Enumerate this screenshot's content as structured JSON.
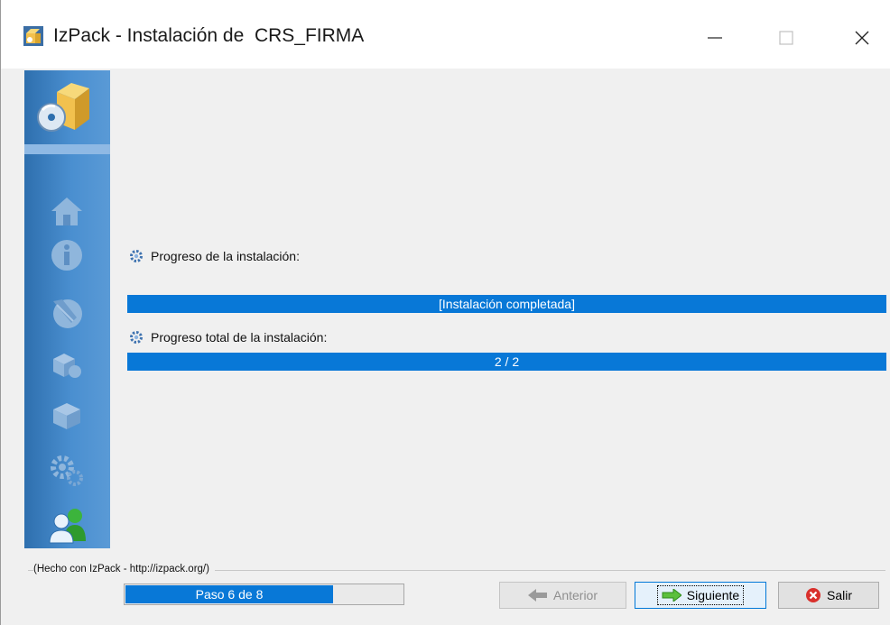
{
  "window": {
    "title": "IzPack - Instalación de  CRS_FIRMA",
    "controls": {
      "minimize": "minimize-icon",
      "maximize": "maximize-icon",
      "close": "close-icon"
    }
  },
  "sidebar": {
    "top_icon": "installer-box-icon",
    "steps": [
      {
        "icon": "home-icon",
        "state": "completed"
      },
      {
        "icon": "info-icon",
        "state": "completed"
      },
      {
        "icon": "license-icon",
        "state": "completed"
      },
      {
        "icon": "packs-icon",
        "state": "completed"
      },
      {
        "icon": "target-icon",
        "state": "completed"
      },
      {
        "icon": "settings-icon",
        "state": "completed"
      },
      {
        "icon": "users-icon",
        "state": "current"
      }
    ]
  },
  "main": {
    "pack_progress": {
      "label": "Progreso de la instalación:",
      "text": "[Instalación completada]",
      "fraction": 1.0
    },
    "total_progress": {
      "label": "Progreso total de la instalación:",
      "text": "2 / 2",
      "fraction": 1.0
    }
  },
  "footer": {
    "credits": "(Hecho con IzPack - http://izpack.org/)",
    "step": {
      "text": "Paso 6 de 8",
      "current": 6,
      "total": 8
    },
    "buttons": {
      "previous": "Anterior",
      "next": "Siguiente",
      "quit": "Salir"
    }
  },
  "colors": {
    "accent": "#0878d7",
    "sidebar": "#4a8fd0",
    "background": "#f0f0f0"
  }
}
